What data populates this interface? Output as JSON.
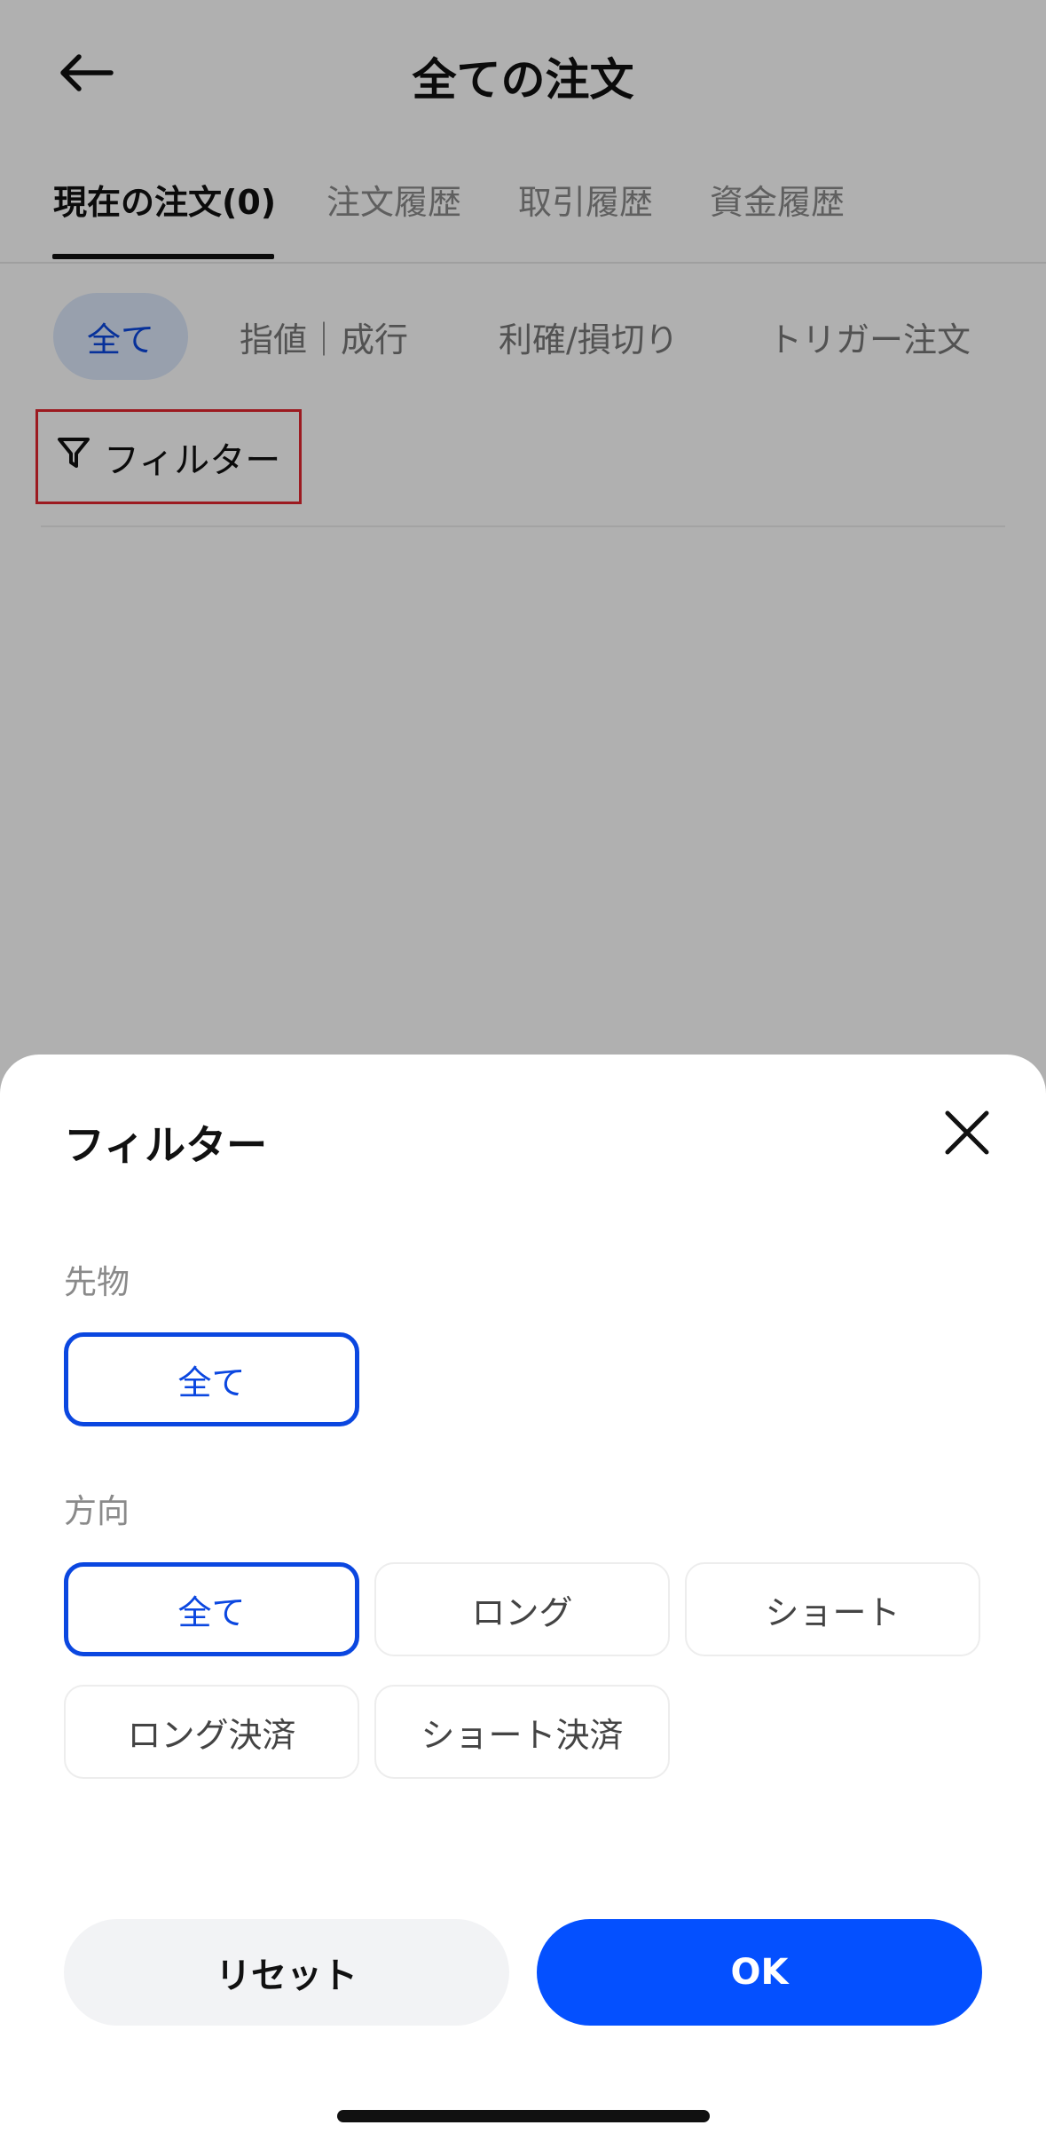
{
  "header": {
    "title": "全ての注文",
    "back_icon": "arrow-left-icon"
  },
  "main_tabs": [
    {
      "label": "現在の注文(0)",
      "active": true
    },
    {
      "label": "注文履歴",
      "active": false
    },
    {
      "label": "取引履歴",
      "active": false
    },
    {
      "label": "資金履歴",
      "active": false
    }
  ],
  "sub_tabs": [
    {
      "label": "全て",
      "active": true
    },
    {
      "label": "指値｜成行",
      "active": false
    },
    {
      "label": "利確/損切り",
      "active": false
    },
    {
      "label": "トリガー注文",
      "active": false
    }
  ],
  "filter_trigger": {
    "label": "フィルター",
    "icon": "funnel-icon"
  },
  "sheet": {
    "title": "フィルター",
    "close_icon": "close-icon",
    "futures": {
      "label": "先物",
      "options": [
        {
          "label": "全て",
          "selected": true
        }
      ]
    },
    "direction": {
      "label": "方向",
      "options": [
        {
          "label": "全て",
          "selected": true
        },
        {
          "label": "ロング",
          "selected": false
        },
        {
          "label": "ショート",
          "selected": false
        },
        {
          "label": "ロング決済",
          "selected": false
        },
        {
          "label": "ショート決済",
          "selected": false
        }
      ]
    },
    "reset_label": "リセット",
    "ok_label": "OK"
  },
  "colors": {
    "accent": "#0b47e0",
    "primary_button": "#0450ff",
    "highlight_box": "#e3262f"
  }
}
